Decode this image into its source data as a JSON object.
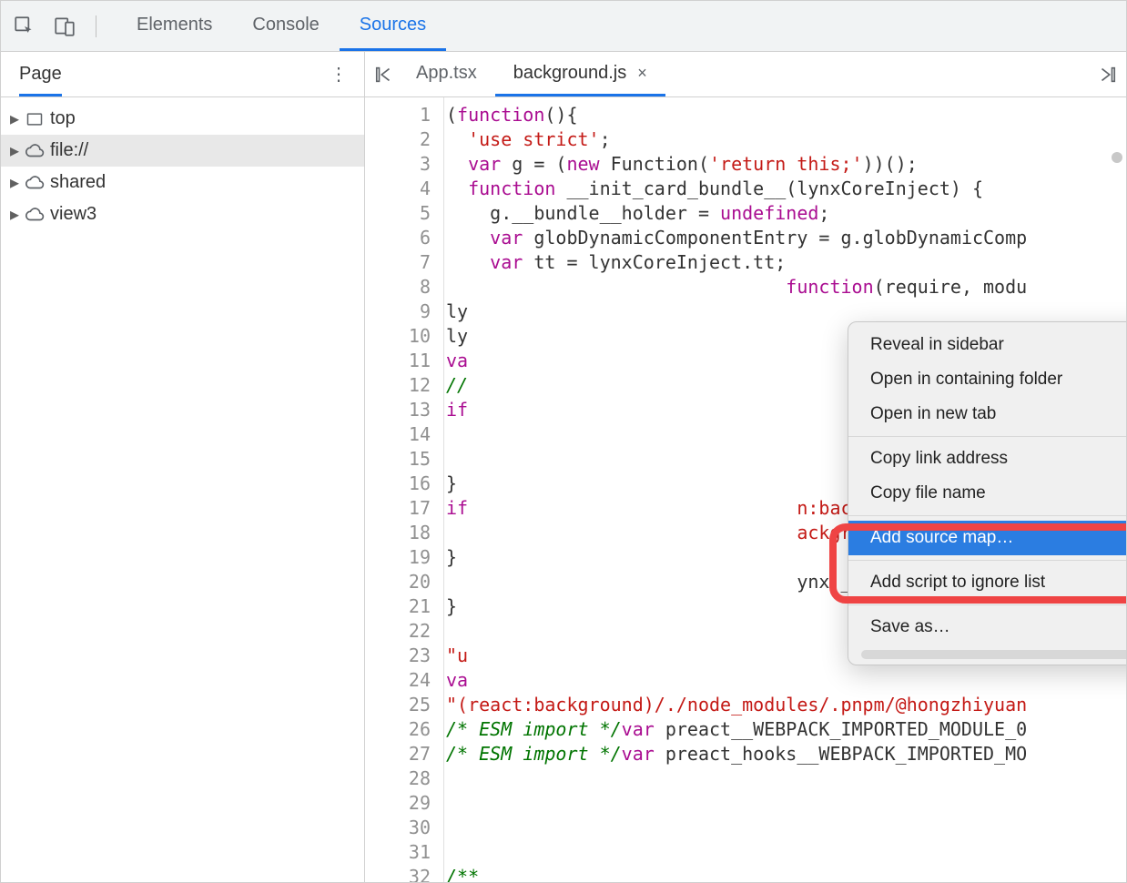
{
  "toolbar": {
    "tabs": [
      "Elements",
      "Console",
      "Sources"
    ],
    "active": 2
  },
  "sidebar": {
    "title": "Page",
    "items": [
      {
        "label": "top",
        "icon": "frame",
        "selected": false
      },
      {
        "label": "file://",
        "icon": "cloud",
        "selected": true
      },
      {
        "label": "shared",
        "icon": "cloud",
        "selected": false
      },
      {
        "label": "view3",
        "icon": "cloud",
        "selected": false
      }
    ]
  },
  "editor": {
    "tabs": [
      {
        "label": "App.tsx",
        "active": false,
        "closeable": false
      },
      {
        "label": "background.js",
        "active": true,
        "closeable": true
      }
    ]
  },
  "context_menu": {
    "items": [
      {
        "label": "Reveal in sidebar"
      },
      {
        "label": "Open in containing folder"
      },
      {
        "label": "Open in new tab"
      },
      {
        "sep": true
      },
      {
        "label": "Copy link address"
      },
      {
        "label": "Copy file name"
      },
      {
        "sep": true
      },
      {
        "label": "Add source map…",
        "hl": true
      },
      {
        "sep": true
      },
      {
        "label": "Add script to ignore list"
      },
      {
        "sep": true
      },
      {
        "label": "Save as…"
      }
    ]
  },
  "code": {
    "lines": [
      {
        "n": 1,
        "html": "(<span class='tok-kw'>function</span>(){"
      },
      {
        "n": 2,
        "html": "  <span class='tok-str'>'use strict'</span>;"
      },
      {
        "n": 3,
        "html": "  <span class='tok-kw'>var</span> g = (<span class='tok-kw'>new</span> Function(<span class='tok-str'>'return this;'</span>))();"
      },
      {
        "n": 4,
        "html": "  <span class='tok-kw'>function</span> __init_card_bundle__(lynxCoreInject) {"
      },
      {
        "n": 5,
        "html": "    g.__bundle__holder = <span class='tok-kw'>undefined</span>;"
      },
      {
        "n": 6,
        "html": "    <span class='tok-kw'>var</span> globDynamicComponentEntry = g.globDynamicComp"
      },
      {
        "n": 7,
        "html": "    <span class='tok-kw'>var</span> tt = lynxCoreInject.tt;"
      },
      {
        "n": 8,
        "html": "                               <span class='tok-kw'>function</span>(require, modu"
      },
      {
        "n": 9,
        "html": "ly"
      },
      {
        "n": 10,
        "html": "ly"
      },
      {
        "n": 11,
        "html": "<span class='tok-kw'>va</span>"
      },
      {
        "n": 12,
        "html": "<span class='tok-com'>//</span>"
      },
      {
        "n": 13,
        "html": "<span class='tok-kw'>if</span>"
      },
      {
        "n": 14,
        "html": " "
      },
      {
        "n": 15,
        "html": " "
      },
      {
        "n": 16,
        "html": "}"
      },
      {
        "n": 17,
        "html": "<span class='tok-kw'>if</span>                              <span class='tok-str'>n:background\"</span>]) {"
      },
      {
        "n": 18,
        "html": "                                <span class='tok-str'>ackground\"</span>] = globDyn"
      },
      {
        "n": 19,
        "html": "}"
      },
      {
        "n": 20,
        "html": "                                ynx.__chunk_entries__["
      },
      {
        "n": 21,
        "html": "}"
      },
      {
        "n": 22,
        "html": " "
      },
      {
        "n": 23,
        "html": "<span class='tok-str'>\"u</span>"
      },
      {
        "n": 24,
        "html": "<span class='tok-kw'>va</span>"
      },
      {
        "n": 25,
        "html": "<span class='tok-str'>\"(react:background)/./node_modules/.pnpm/@hongzhiyuan</span>"
      },
      {
        "n": 26,
        "html": "<span class='tok-com'>/* ESM import */</span><span class='tok-kw'>var</span> preact__WEBPACK_IMPORTED_MODULE_0"
      },
      {
        "n": 27,
        "html": "<span class='tok-com'>/* ESM import */</span><span class='tok-kw'>var</span> preact_hooks__WEBPACK_IMPORTED_MO"
      },
      {
        "n": 28,
        "html": " "
      },
      {
        "n": 29,
        "html": " "
      },
      {
        "n": 30,
        "html": " "
      },
      {
        "n": 31,
        "html": " "
      },
      {
        "n": 32,
        "html": "<span class='tok-com'>/**</span>"
      }
    ]
  }
}
